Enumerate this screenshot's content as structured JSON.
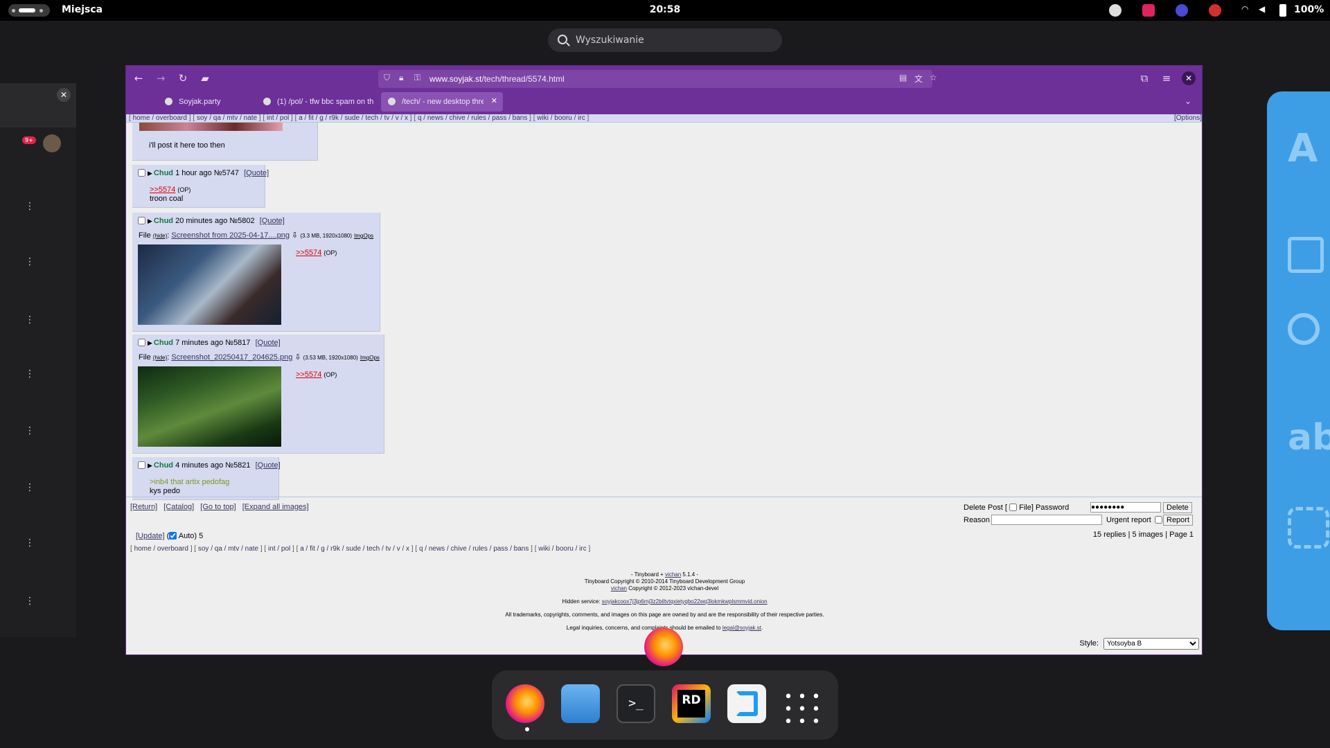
{
  "topbar": {
    "places_label": "Miejsca",
    "clock": "20:58",
    "battery": "100%"
  },
  "search": {
    "placeholder": "Wyszukiwanie"
  },
  "browser": {
    "url_host": "www.soyjak.st",
    "url_path": "/tech/thread/5574.html",
    "tabs": [
      {
        "title": "Soyjak.party"
      },
      {
        "title": "(1) /pol/ - tfw bbc spam on th"
      },
      {
        "title": "/tech/ - new desktop thre"
      }
    ]
  },
  "boardlist": {
    "groups": [
      "home / overboard",
      "soy / qa / mtv / nate",
      "int / pol",
      "a / fit / g / r9k / sude / tech / tv / v / x",
      "q / news / chive / rules / pass / bans",
      "wiki / booru / irc"
    ],
    "options": "[Options]"
  },
  "thread": {
    "prev_post_text": "i'll post it here too then",
    "posts": [
      {
        "name": "Chud",
        "time": "1 hour ago",
        "no": "№5747",
        "quote": "[Quote]",
        "reply_link": ">>5574",
        "op": "(OP)",
        "text": "troon coal"
      },
      {
        "name": "Chud",
        "time": "20 minutes ago",
        "no": "№5802",
        "quote": "[Quote]",
        "file_label": "File",
        "hide": "(hide)",
        "file_name": "Screenshot from 2025-04-17....png",
        "file_meta": "(3.3 MB, 1920x1080)",
        "imgops": "ImgOps",
        "reply_link": ">>5574",
        "op": "(OP)"
      },
      {
        "name": "Chud",
        "time": "7 minutes ago",
        "no": "№5817",
        "quote": "[Quote]",
        "file_label": "File",
        "hide": "(hide)",
        "file_name": "Screenshot_20250417_204625.png",
        "file_meta": "(3.53 MB, 1920x1080)",
        "imgops": "ImgOps",
        "reply_link": ">>5574",
        "op": "(OP)"
      },
      {
        "name": "Chud",
        "time": "4 minutes ago",
        "no": "№5821",
        "quote": "[Quote]",
        "greentext": ">inb4 that artix pedofag",
        "text": "kys pedo"
      }
    ]
  },
  "nav_links": [
    "[Return]",
    "[Catalog]",
    "[Go to top]",
    "[Expand all images]"
  ],
  "delete_form": {
    "delete_post": "Delete Post [",
    "file": "File]",
    "password_label": "Password",
    "password_value": "●●●●●●●●",
    "delete_button": "Delete",
    "reason_label": "Reason",
    "urgent_label": "Urgent report",
    "report_button": "Report"
  },
  "update": {
    "link": "[Update]",
    "open_paren": "(",
    "auto": "Auto) 5"
  },
  "stats": "15 replies | 5 images | Page 1",
  "footer": {
    "line1_a": "- Tinyboard +",
    "line1_link": "vichan",
    "line1_b": "5.1.4 -",
    "line2": "Tinyboard Copyright © 2010-2014 Tinyboard Development Group",
    "line3_link": "vichan",
    "line3": "Copyright © 2012-2023 vichan-devel",
    "hidden_label": "Hidden service:",
    "hidden_link": "soyjakcoox7j3jp6mj3z2biltvtqxietyqbo22wq3lokmkwplsmmvid.onion",
    "trademarks": "All trademarks, copyrights, comments, and images on this page are owned by and are the responsibility of their respective parties.",
    "legal_a": "Legal inquiries, concerns, and complaints should be emailed to",
    "legal_link": "legal@soyjak.st",
    "legal_b": "."
  },
  "style_selector": {
    "label": "Style:",
    "value": "Yotsoyba B"
  },
  "colors": {
    "browser_toolbar": "#6d2f98",
    "post_bg": "#d6daf0",
    "name_green": "#117743",
    "quotelink_red": "#dd0000",
    "greentext": "#789922",
    "side_panel_blue": "#3d9ee6"
  }
}
